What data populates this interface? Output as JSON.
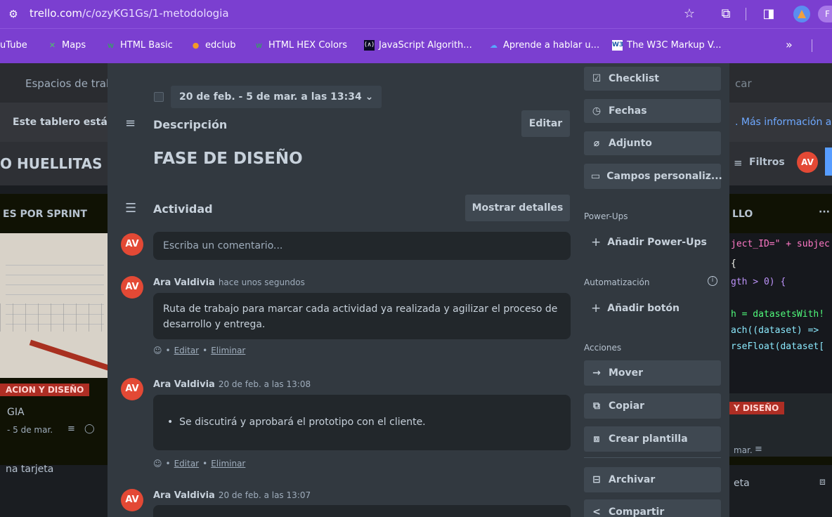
{
  "browser": {
    "url_host": "trello.com",
    "url_path": "/c/ozyKG1Gs/1-metodologia",
    "star_icon": "star-icon",
    "extensions_icon": "puzzle-icon",
    "sidepanel_icon": "sidepanel-icon",
    "profile_letter": "F"
  },
  "bookmarks": [
    {
      "label": "uTube",
      "icon": "youtube-icon"
    },
    {
      "label": "Maps",
      "icon": "maps-icon"
    },
    {
      "label": "HTML Basic",
      "icon": "w3-icon"
    },
    {
      "label": "edclub",
      "icon": "edclub-icon"
    },
    {
      "label": "HTML HEX Colors",
      "icon": "w3-icon"
    },
    {
      "label": "JavaScript Algorith...",
      "icon": "freecodecamp-icon"
    },
    {
      "label": "Aprende a hablar u...",
      "icon": "cloud-icon"
    },
    {
      "label": "The W3C Markup V...",
      "icon": "w3c-icon"
    },
    {
      "label": "»",
      "icon": "more-bookmarks-icon"
    }
  ],
  "board": {
    "nav_workspaces": "Espacios de trab",
    "banner_text": "Este tablero está c",
    "board_title": "O HUELLITAS D",
    "search_partial": "car",
    "banner_more": ". Más información a",
    "filters": "Filtros",
    "member_initials": "AV",
    "left_list_title": "ES POR SPRINT",
    "left_label": "ACION Y DISEÑO",
    "left_card_title": "GIA",
    "left_card_date": "- 5 de mar.",
    "left_add_card": "na tarjeta",
    "right_list_title": "LLO",
    "right_list_more": "···",
    "right_label": "Y DISEÑO",
    "right_card_date": "mar.",
    "right_add_card": "eta",
    "code_lines": [
      {
        "text": "ject_ID=\" + subjec",
        "color": "#ff79c6"
      },
      {
        "text": "{",
        "color": "#f8f8f2"
      },
      {
        "text": "gth > 0) {",
        "color": "#bd93f9"
      },
      {
        "text": "h = datasetsWith!",
        "color": "#50fa7b"
      },
      {
        "text": "ach((dataset) =>",
        "color": "#8be9fd"
      },
      {
        "text": "rseFloat(dataset[",
        "color": "#8be9fd"
      }
    ]
  },
  "modal": {
    "dates_value": "20 de feb. - 5 de mar. a las 13:34",
    "description_title": "Descripción",
    "edit_button": "Editar",
    "description_text": "FASE DE DISEÑO",
    "activity_title": "Actividad",
    "show_details": "Mostrar detalles",
    "user_initials": "AV",
    "comment_placeholder": "Escriba un comentario...",
    "comments": [
      {
        "author": "Ara Valdivia",
        "time": "hace unos segundos",
        "text": "Ruta de trabajo para marcar cada actividad ya realizada y agilizar el proceso de desarrollo y entrega.",
        "edit": "Editar",
        "delete": "Eliminar"
      },
      {
        "author": "Ara Valdivia",
        "time": "20 de feb. a las 13:08",
        "text": "Se discutirá y aprobará el prototipo con el cliente.",
        "edit": "Editar",
        "delete": "Eliminar"
      },
      {
        "author": "Ara Valdivia",
        "time": "20 de feb. a las 13:07"
      }
    ],
    "dot": "•"
  },
  "sidebar": {
    "checklist": "Checklist",
    "dates": "Fechas",
    "attachment": "Adjunto",
    "custom_fields": "Campos personaliz...",
    "powerups_label": "Power-Ups",
    "add_powerups": "Añadir Power-Ups",
    "automation_label": "Automatización",
    "add_button": "Añadir botón",
    "actions_label": "Acciones",
    "move": "Mover",
    "copy": "Copiar",
    "template": "Crear plantilla",
    "archive": "Archivar",
    "share": "Compartir"
  },
  "colors": {
    "modal_bg": "#323940",
    "avatar": "#e34935",
    "chrome": "#7b3fd0",
    "label_red": "#ae2e24"
  }
}
